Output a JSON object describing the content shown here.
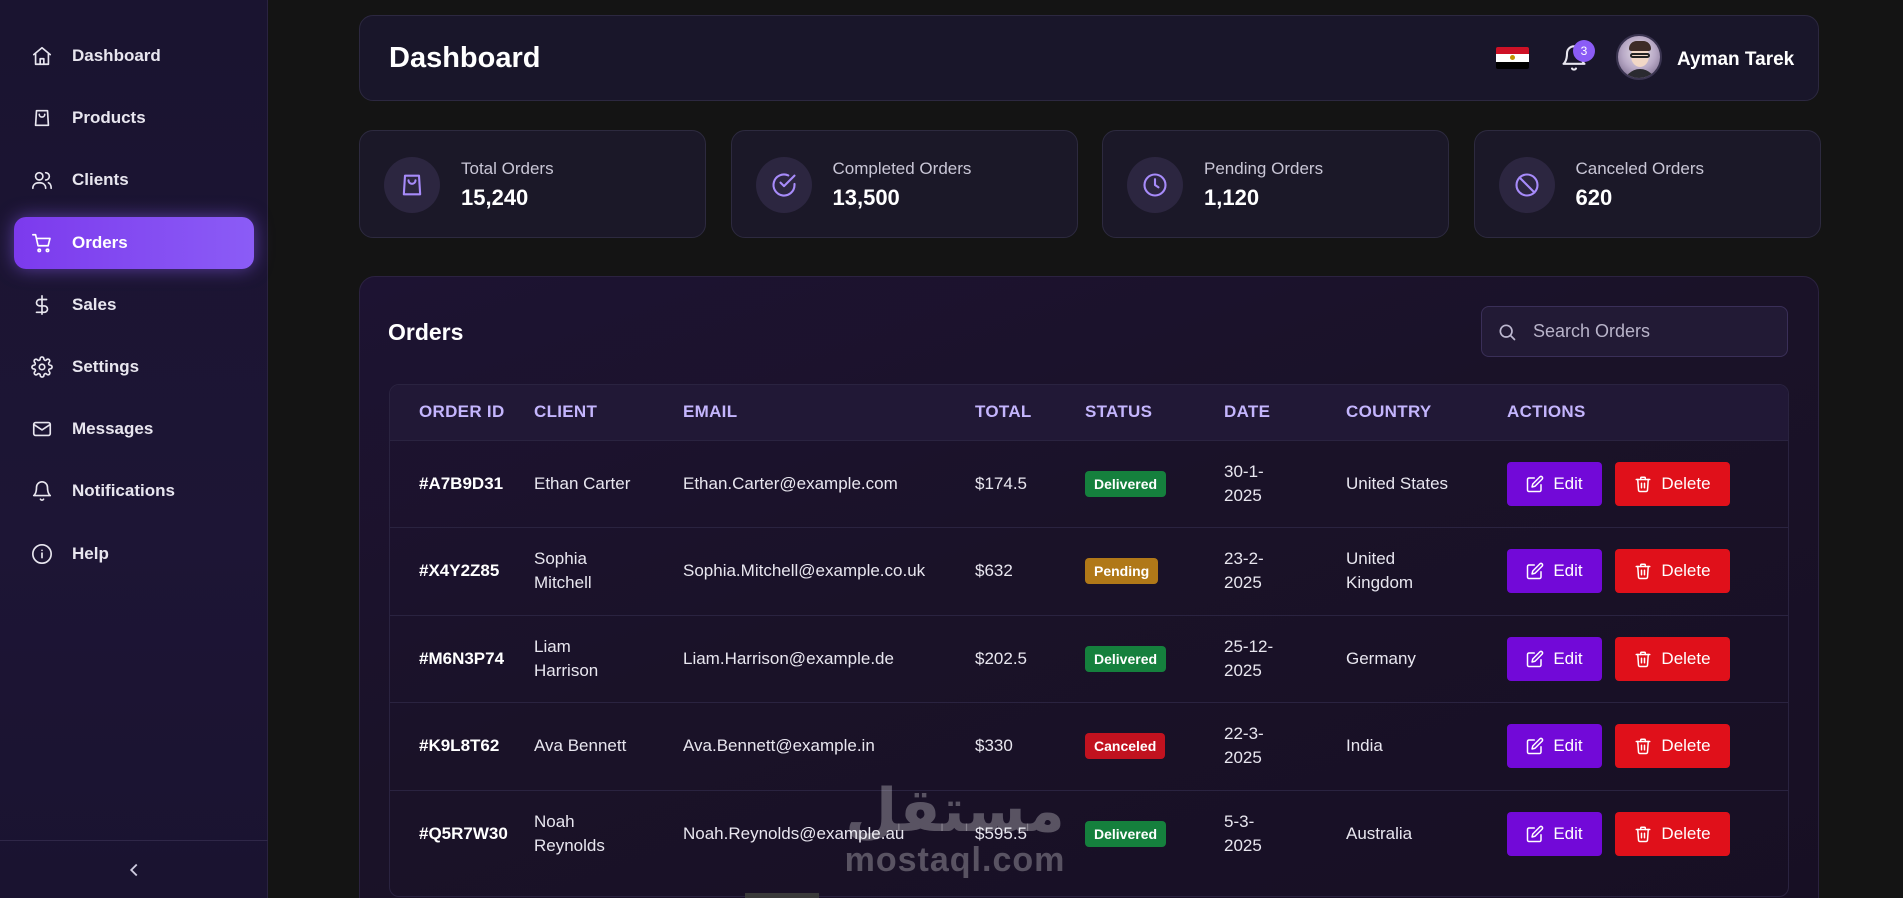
{
  "sidebar": {
    "items": [
      {
        "label": "Dashboard",
        "icon": "home-icon",
        "active": false
      },
      {
        "label": "Products",
        "icon": "shopping-bag-icon",
        "active": false
      },
      {
        "label": "Clients",
        "icon": "users-icon",
        "active": false
      },
      {
        "label": "Orders",
        "icon": "cart-icon",
        "active": true
      },
      {
        "label": "Sales",
        "icon": "dollar-icon",
        "active": false
      },
      {
        "label": "Settings",
        "icon": "gear-icon",
        "active": false
      },
      {
        "label": "Messages",
        "icon": "mail-icon",
        "active": false
      },
      {
        "label": "Notifications",
        "icon": "bell-icon",
        "active": false
      },
      {
        "label": "Help",
        "icon": "info-icon",
        "active": false
      }
    ],
    "collapse_icon": "chevron-left-icon"
  },
  "header": {
    "title": "Dashboard",
    "notification_count": "3",
    "user_name": "Ayman Tarek",
    "flag_icon": "egypt-flag-icon"
  },
  "stats": [
    {
      "label": "Total Orders",
      "value": "15,240",
      "icon": "shopping-bag-icon"
    },
    {
      "label": "Completed Orders",
      "value": "13,500",
      "icon": "check-circle-icon"
    },
    {
      "label": "Pending Orders",
      "value": "1,120",
      "icon": "clock-icon"
    },
    {
      "label": "Canceled Orders",
      "value": "620",
      "icon": "ban-icon"
    }
  ],
  "orders": {
    "title": "Orders",
    "search_placeholder": "Search Orders",
    "columns": [
      "ORDER ID",
      "CLIENT",
      "EMAIL",
      "TOTAL",
      "STATUS",
      "DATE",
      "COUNTRY",
      "ACTIONS"
    ],
    "rows": [
      {
        "id": "#A7B9D31",
        "client": "Ethan Carter",
        "email": "Ethan.Carter@example.com",
        "total": "$174.5",
        "status": "Delivered",
        "date": "30-1-2025",
        "country": "United States"
      },
      {
        "id": "#X4Y2Z85",
        "client": "Sophia Mitchell",
        "email": "Sophia.Mitchell@example.co.uk",
        "total": "$632",
        "status": "Pending",
        "date": "23-2-2025",
        "country": "United Kingdom"
      },
      {
        "id": "#M6N3P74",
        "client": "Liam Harrison",
        "email": "Liam.Harrison@example.de",
        "total": "$202.5",
        "status": "Delivered",
        "date": "25-12-2025",
        "country": "Germany"
      },
      {
        "id": "#K9L8T62",
        "client": "Ava Bennett",
        "email": "Ava.Bennett@example.in",
        "total": "$330",
        "status": "Canceled",
        "date": "22-3-2025",
        "country": "India"
      },
      {
        "id": "#Q5R7W30",
        "client": "Noah Reynolds",
        "email": "Noah.Reynolds@example.au",
        "total": "$595.5",
        "status": "Delivered",
        "date": "5-3-2025",
        "country": "Australia"
      }
    ],
    "edit_label": "Edit",
    "delete_label": "Delete"
  },
  "watermark": {
    "arabic": "مستقل",
    "latin": "mostaql.com"
  },
  "colors": {
    "accent": "#8b5cf6",
    "delivered": "#15803d",
    "pending": "#b07818",
    "canceled": "#c1121f",
    "edit": "#7209d8",
    "delete": "#e0101a"
  }
}
